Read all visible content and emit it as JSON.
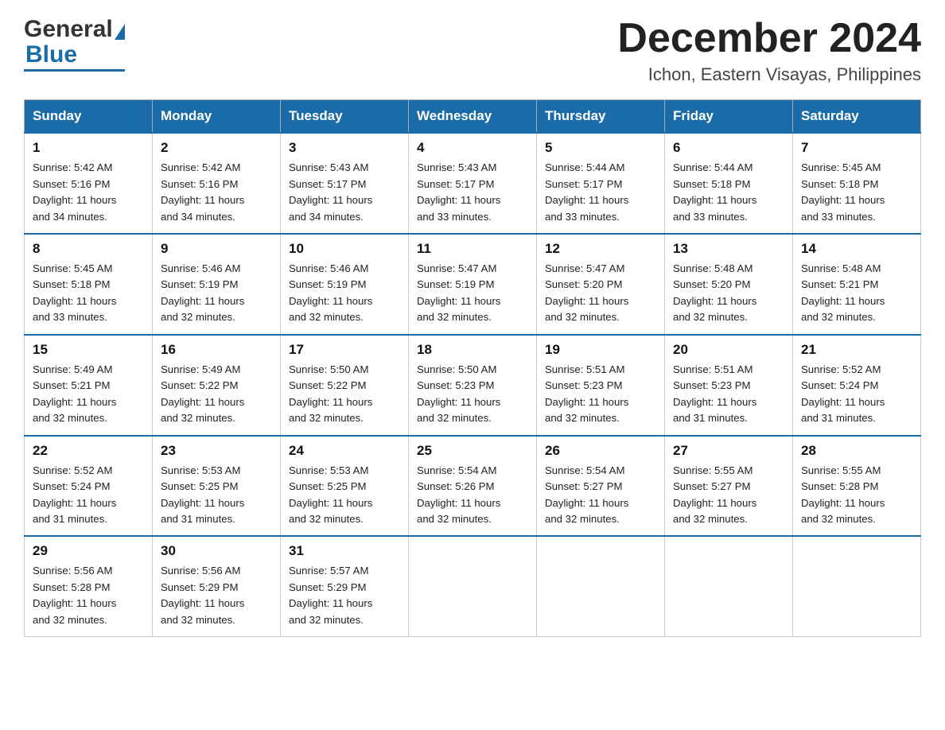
{
  "header": {
    "logo_general": "General",
    "logo_blue": "Blue",
    "month_title": "December 2024",
    "location": "Ichon, Eastern Visayas, Philippines"
  },
  "days_of_week": [
    "Sunday",
    "Monday",
    "Tuesday",
    "Wednesday",
    "Thursday",
    "Friday",
    "Saturday"
  ],
  "weeks": [
    [
      {
        "day": "1",
        "sunrise": "5:42 AM",
        "sunset": "5:16 PM",
        "daylight": "11 hours and 34 minutes."
      },
      {
        "day": "2",
        "sunrise": "5:42 AM",
        "sunset": "5:16 PM",
        "daylight": "11 hours and 34 minutes."
      },
      {
        "day": "3",
        "sunrise": "5:43 AM",
        "sunset": "5:17 PM",
        "daylight": "11 hours and 34 minutes."
      },
      {
        "day": "4",
        "sunrise": "5:43 AM",
        "sunset": "5:17 PM",
        "daylight": "11 hours and 33 minutes."
      },
      {
        "day": "5",
        "sunrise": "5:44 AM",
        "sunset": "5:17 PM",
        "daylight": "11 hours and 33 minutes."
      },
      {
        "day": "6",
        "sunrise": "5:44 AM",
        "sunset": "5:18 PM",
        "daylight": "11 hours and 33 minutes."
      },
      {
        "day": "7",
        "sunrise": "5:45 AM",
        "sunset": "5:18 PM",
        "daylight": "11 hours and 33 minutes."
      }
    ],
    [
      {
        "day": "8",
        "sunrise": "5:45 AM",
        "sunset": "5:18 PM",
        "daylight": "11 hours and 33 minutes."
      },
      {
        "day": "9",
        "sunrise": "5:46 AM",
        "sunset": "5:19 PM",
        "daylight": "11 hours and 32 minutes."
      },
      {
        "day": "10",
        "sunrise": "5:46 AM",
        "sunset": "5:19 PM",
        "daylight": "11 hours and 32 minutes."
      },
      {
        "day": "11",
        "sunrise": "5:47 AM",
        "sunset": "5:19 PM",
        "daylight": "11 hours and 32 minutes."
      },
      {
        "day": "12",
        "sunrise": "5:47 AM",
        "sunset": "5:20 PM",
        "daylight": "11 hours and 32 minutes."
      },
      {
        "day": "13",
        "sunrise": "5:48 AM",
        "sunset": "5:20 PM",
        "daylight": "11 hours and 32 minutes."
      },
      {
        "day": "14",
        "sunrise": "5:48 AM",
        "sunset": "5:21 PM",
        "daylight": "11 hours and 32 minutes."
      }
    ],
    [
      {
        "day": "15",
        "sunrise": "5:49 AM",
        "sunset": "5:21 PM",
        "daylight": "11 hours and 32 minutes."
      },
      {
        "day": "16",
        "sunrise": "5:49 AM",
        "sunset": "5:22 PM",
        "daylight": "11 hours and 32 minutes."
      },
      {
        "day": "17",
        "sunrise": "5:50 AM",
        "sunset": "5:22 PM",
        "daylight": "11 hours and 32 minutes."
      },
      {
        "day": "18",
        "sunrise": "5:50 AM",
        "sunset": "5:23 PM",
        "daylight": "11 hours and 32 minutes."
      },
      {
        "day": "19",
        "sunrise": "5:51 AM",
        "sunset": "5:23 PM",
        "daylight": "11 hours and 32 minutes."
      },
      {
        "day": "20",
        "sunrise": "5:51 AM",
        "sunset": "5:23 PM",
        "daylight": "11 hours and 31 minutes."
      },
      {
        "day": "21",
        "sunrise": "5:52 AM",
        "sunset": "5:24 PM",
        "daylight": "11 hours and 31 minutes."
      }
    ],
    [
      {
        "day": "22",
        "sunrise": "5:52 AM",
        "sunset": "5:24 PM",
        "daylight": "11 hours and 31 minutes."
      },
      {
        "day": "23",
        "sunrise": "5:53 AM",
        "sunset": "5:25 PM",
        "daylight": "11 hours and 31 minutes."
      },
      {
        "day": "24",
        "sunrise": "5:53 AM",
        "sunset": "5:25 PM",
        "daylight": "11 hours and 32 minutes."
      },
      {
        "day": "25",
        "sunrise": "5:54 AM",
        "sunset": "5:26 PM",
        "daylight": "11 hours and 32 minutes."
      },
      {
        "day": "26",
        "sunrise": "5:54 AM",
        "sunset": "5:27 PM",
        "daylight": "11 hours and 32 minutes."
      },
      {
        "day": "27",
        "sunrise": "5:55 AM",
        "sunset": "5:27 PM",
        "daylight": "11 hours and 32 minutes."
      },
      {
        "day": "28",
        "sunrise": "5:55 AM",
        "sunset": "5:28 PM",
        "daylight": "11 hours and 32 minutes."
      }
    ],
    [
      {
        "day": "29",
        "sunrise": "5:56 AM",
        "sunset": "5:28 PM",
        "daylight": "11 hours and 32 minutes."
      },
      {
        "day": "30",
        "sunrise": "5:56 AM",
        "sunset": "5:29 PM",
        "daylight": "11 hours and 32 minutes."
      },
      {
        "day": "31",
        "sunrise": "5:57 AM",
        "sunset": "5:29 PM",
        "daylight": "11 hours and 32 minutes."
      },
      null,
      null,
      null,
      null
    ]
  ],
  "labels": {
    "sunrise": "Sunrise:",
    "sunset": "Sunset:",
    "daylight": "Daylight:"
  }
}
